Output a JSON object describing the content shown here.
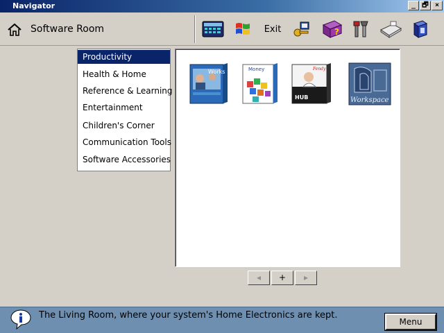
{
  "window": {
    "title": "Navigator",
    "controls": [
      "_",
      "🗗",
      "×"
    ]
  },
  "header": {
    "room_title": "Software Room",
    "toolbar": [
      {
        "icon": "calculator-keypad-icon"
      },
      {
        "icon": "windows-flag-icon"
      },
      {
        "label": "Exit"
      },
      {
        "icon": "key-setup-icon"
      },
      {
        "icon": "help-book-icon"
      },
      {
        "icon": "tools-icon"
      },
      {
        "icon": "fax-phone-icon"
      },
      {
        "icon": "speaker-device-icon"
      }
    ]
  },
  "categories": [
    {
      "label": "Productivity",
      "selected": true
    },
    {
      "label": "Health & Home",
      "selected": false
    },
    {
      "label": "Reference & Learning",
      "selected": false
    },
    {
      "label": "Entertainment",
      "selected": false
    },
    {
      "label": "Children's Corner",
      "selected": false
    },
    {
      "label": "Communication Tools",
      "selected": false
    },
    {
      "label": "Software Accessories",
      "selected": false
    }
  ],
  "software": [
    {
      "name": "Works",
      "icon": "works-box-icon"
    },
    {
      "name": "Money",
      "icon": "money-box-icon"
    },
    {
      "name": "Action Hub",
      "icon": "action-hub-box-icon"
    },
    {
      "name": "Workspace",
      "icon": "workspace-box-icon"
    }
  ],
  "pager": {
    "prev": "◂",
    "add": "+",
    "next": "▸"
  },
  "status": {
    "text": "The Living Room, where your system's Home Electronics are kept.",
    "menu_label": "Menu"
  }
}
